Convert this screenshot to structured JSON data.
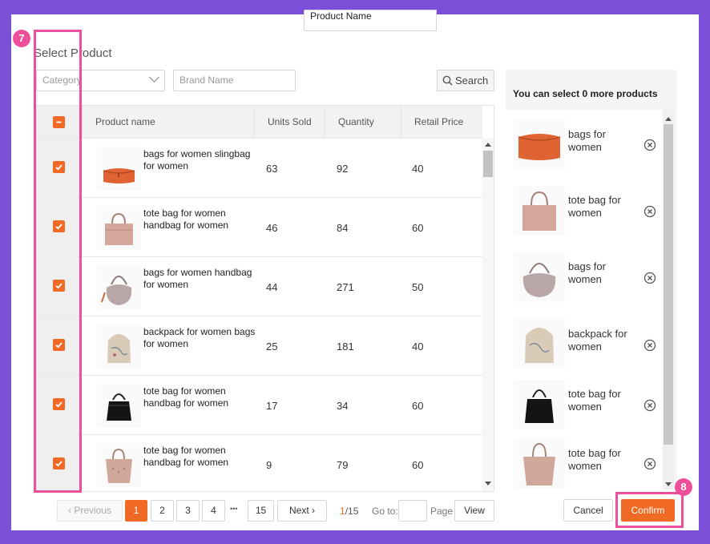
{
  "modal": {
    "title": "Select Product"
  },
  "filters": {
    "category_placeholder": "Category",
    "brand_placeholder": "Brand Name",
    "product_placeholder": "Product Name",
    "search_label": "Search"
  },
  "table": {
    "headers": {
      "name": "Product name",
      "units_sold": "Units Sold",
      "quantity": "Quantity",
      "retail_price": "Retail Price"
    },
    "rows": [
      {
        "name": "bags for women slingbag for women",
        "units_sold": "63",
        "quantity": "92",
        "retail_price": "40",
        "checked": true,
        "image": "orange-crossbody-bag"
      },
      {
        "name": "tote bag for women handbag for women",
        "units_sold": "46",
        "quantity": "84",
        "retail_price": "60",
        "checked": true,
        "image": "pink-tote-bag"
      },
      {
        "name": "bags for women handbag for women",
        "units_sold": "44",
        "quantity": "271",
        "retail_price": "50",
        "checked": true,
        "image": "grey-hobo-bag"
      },
      {
        "name": "backpack for women bags for women",
        "units_sold": "25",
        "quantity": "181",
        "retail_price": "40",
        "checked": true,
        "image": "floral-backpack"
      },
      {
        "name": "tote bag for women handbag for women",
        "units_sold": "17",
        "quantity": "34",
        "retail_price": "60",
        "checked": true,
        "image": "black-bucket-bag"
      },
      {
        "name": "tote bag for women handbag for women",
        "units_sold": "9",
        "quantity": "79",
        "retail_price": "60",
        "checked": true,
        "image": "pink-perforated-tote"
      }
    ]
  },
  "pagination": {
    "previous": "Previous",
    "pages": [
      "1",
      "2",
      "3",
      "4"
    ],
    "ellipsis": "•••",
    "last_page": "15",
    "next": "Next",
    "current": "1",
    "total": "/15",
    "goto_label": "Go to:",
    "page_label": "Page",
    "view": "View"
  },
  "selected_panel": {
    "header": "You can select 0 more products",
    "items": [
      {
        "name": "bags for women",
        "image": "orange-crossbody-bag"
      },
      {
        "name": "tote bag for women",
        "image": "pink-tote-bag"
      },
      {
        "name": "bags for women",
        "image": "grey-hobo-bag"
      },
      {
        "name": "backpack for women",
        "image": "floral-backpack"
      },
      {
        "name": "tote bag for women",
        "image": "black-bucket-bag"
      },
      {
        "name": "tote bag for women",
        "image": "pink-perforated-tote"
      }
    ]
  },
  "actions": {
    "cancel": "Cancel",
    "confirm": "Confirm"
  },
  "annotations": {
    "badge_checkbox": "7",
    "badge_confirm": "8"
  },
  "colors": {
    "accent": "#f06a25",
    "highlight": "#ee4f9a",
    "background": "#7b4fd8"
  }
}
